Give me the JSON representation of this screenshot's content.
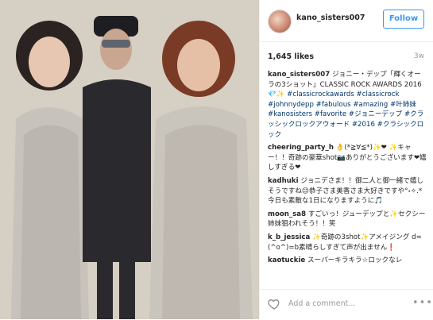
{
  "post": {
    "username": "kano_sisters007",
    "follow_label": "Follow",
    "likes": "1,645 likes",
    "age": "3w"
  },
  "comments": [
    {
      "user": "kano_sisters007",
      "text": "ジョニー・デップ「輝くオーラの3ショット」CLASSIC ROCK AWARDS 2016💎✨",
      "tags": "#classicrockawards #classicrock #johnnydepp #fabulous #amazing #叶姉妹 #kanosisters #favorite #ジョニーデップ #クラッシックロックアウォード #2016 #クラシックロック"
    },
    {
      "user": "cheering_party_h",
      "text": "👌(*≧∀≦*)✨❤ ✨キャー！！奇跡の豪華shot📷ありがとうございます❤嬉しすぎる❤",
      "tags": ""
    },
    {
      "user": "kadhuki",
      "text": "ジョニデさま！！御二人と御一緒で嬉しそうですね😉恭子さま美香さま大好きですや°˖✧.*今日も素敵な1日になりますように🎵",
      "tags": ""
    },
    {
      "user": "moon_sa8",
      "text": "すごいっ！ジューデップと✨セクシー姉妹狙われそう！！笑",
      "tags": ""
    },
    {
      "user": "k_b_jessica",
      "text": "✨奇跡の3shot✨アメイジング d=(^o^)=b素晴らしすぎて声が出ません❗",
      "tags": ""
    },
    {
      "user": "kaotuckie",
      "text": "スーパーキラキラ☆ロックなレ",
      "tags": ""
    }
  ],
  "footer": {
    "add_comment_placeholder": "Add a comment...",
    "more_label": "•••"
  },
  "icons": {
    "heart": "heart-outline-icon",
    "more": "more-dots-icon"
  }
}
